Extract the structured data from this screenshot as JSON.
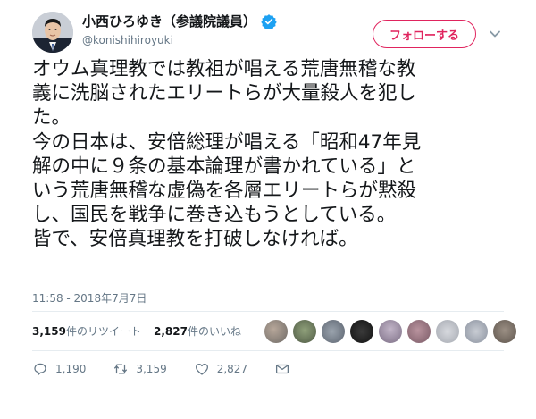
{
  "user": {
    "display_name": "小西ひろゆき（参議院議員）",
    "handle": "@konishihiroyuki",
    "verified": true
  },
  "follow_button": {
    "label": "フォローする"
  },
  "tweet": {
    "lines": [
      "オウム真理教では教祖が唱える荒唐無稽な教",
      "義に洗脳されたエリートらが大量殺人を犯し",
      "た。",
      "今の日本は、安倍総理が唱える「昭和47年見",
      "解の中に９条の基本論理が書かれている」と",
      "いう荒唐無稽な虚偽を各層エリートらが黙殺",
      "し、国民を戦争に巻き込もうとしている。",
      "皆で、安倍真理教を打破しなければ。"
    ],
    "timestamp": "11:58 - 2018年7月7日"
  },
  "stats": {
    "retweets_count": "3,159",
    "retweets_label": "件のリツイート",
    "likes_count": "2,827",
    "likes_label": "件のいいね"
  },
  "actions": {
    "reply_count": "1,190",
    "retweet_count": "3,159",
    "like_count": "2,827"
  },
  "colors": {
    "accent": "#e0245e",
    "verified": "#1da1f2",
    "muted": "#657786"
  }
}
